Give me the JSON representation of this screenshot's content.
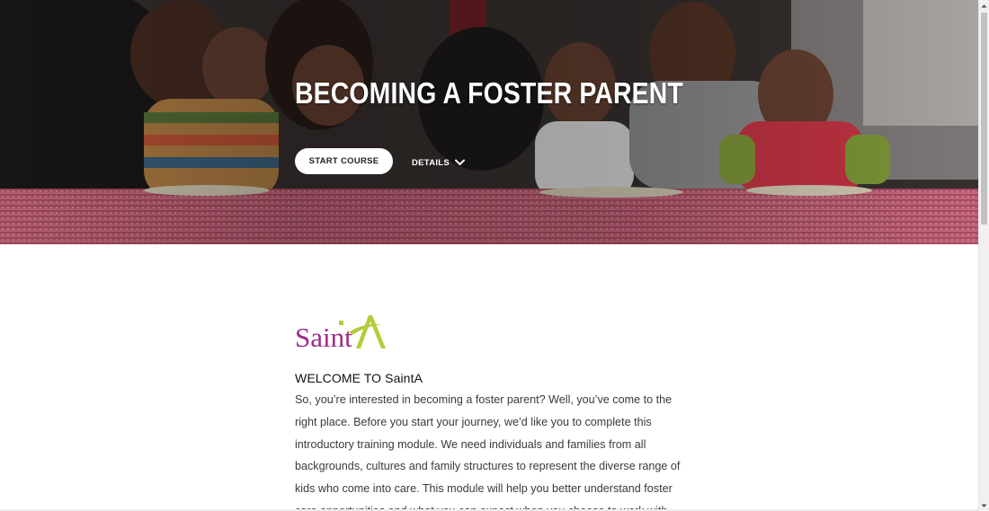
{
  "hero": {
    "title": "BECOMING A FOSTER PARENT",
    "start_button_label": "START COURSE",
    "details_label": "DETAILS",
    "details_icon": "chevron-down-icon",
    "image": "family photo at a dining table"
  },
  "content": {
    "logo_text": "Saint",
    "logo_accent": "A",
    "welcome_heading": "WELCOME TO SaintA",
    "intro_paragraph": "So, you’re interested in becoming a foster parent? Well, you’ve come to the right place. Before you start your journey, we’d like you to complete this introductory training module. We need individuals and families from all backgrounds, cultures and family structures to represent the diverse range of kids who come into care. This module will help you better understand foster care opportunities and what you can expect when you choose to work with"
  },
  "colors": {
    "logo_purple": "#9b2a8f",
    "logo_green": "#b5cc3a",
    "button_bg": "#ffffff",
    "title_color": "#ffffff",
    "body_text": "#3a3a3a"
  }
}
